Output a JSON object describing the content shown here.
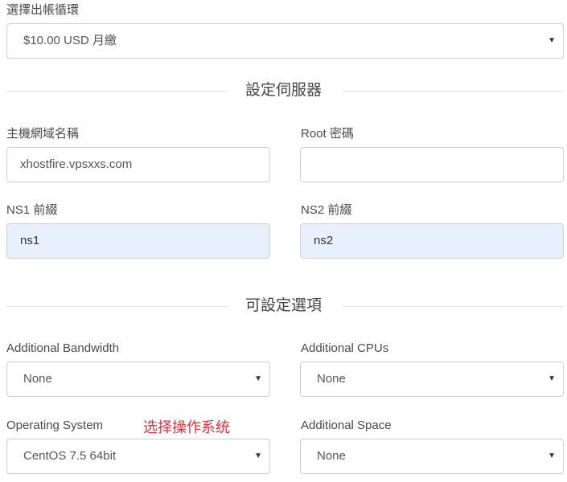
{
  "billing": {
    "label": "選擇出帳循環",
    "selected": "$10.00 USD 月繳"
  },
  "server_setup": {
    "title": "設定伺服器",
    "hostname_label": "主機網域名稱",
    "hostname_value": "xhostfire.vpsxxs.com",
    "root_label": "Root 密碼",
    "root_value": "",
    "ns1_label": "NS1 前綴",
    "ns1_value": "ns1",
    "ns2_label": "NS2 前綴",
    "ns2_value": "ns2"
  },
  "options": {
    "title": "可設定選項",
    "bandwidth_label": "Additional Bandwidth",
    "bandwidth_value": "None",
    "cpus_label": "Additional CPUs",
    "cpus_value": "None",
    "os_label": "Operating System",
    "os_value": "CentOS 7.5 64bit",
    "os_annotation": "选择操作系统",
    "space_label": "Additional Space",
    "space_value": "None"
  },
  "icons": {
    "dropdown": "chevron-down-icon"
  }
}
